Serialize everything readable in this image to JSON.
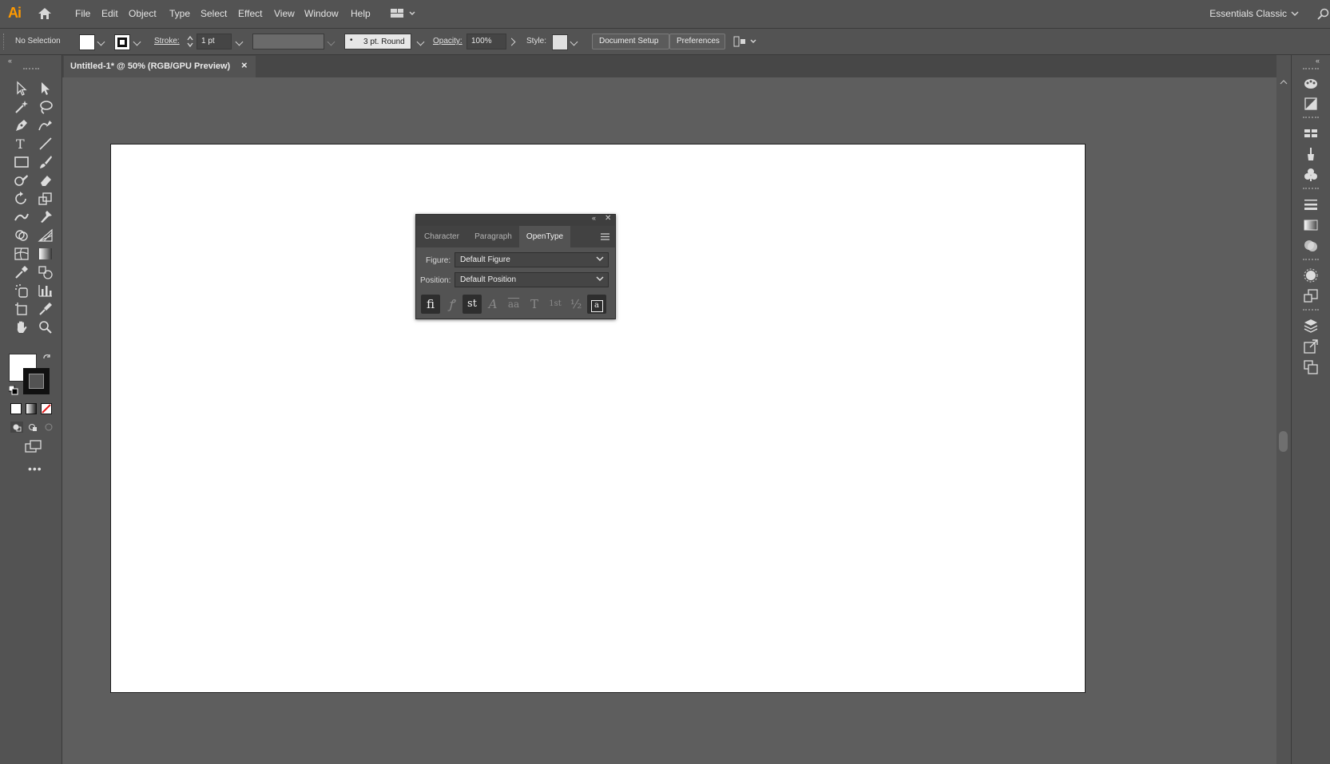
{
  "app": {
    "logo": "Ai",
    "workspace": "Essentials Classic"
  },
  "menu": [
    "File",
    "Edit",
    "Object",
    "Type",
    "Select",
    "Effect",
    "View",
    "Window",
    "Help"
  ],
  "control_bar": {
    "selection": "No Selection",
    "stroke_label": "Stroke:",
    "stroke_value": "1 pt",
    "brush": "3 pt. Round",
    "opacity_label": "Opacity:",
    "opacity_value": "100%",
    "style_label": "Style:",
    "document_setup": "Document Setup",
    "preferences": "Preferences"
  },
  "document_tab": {
    "title": "Untitled-1* @ 50% (RGB/GPU Preview)",
    "close": "×"
  },
  "opentype_panel": {
    "tabs": [
      "Character",
      "Paragraph",
      "OpenType"
    ],
    "active_tab": "OpenType",
    "figure_label": "Figure:",
    "figure_value": "Default Figure",
    "position_label": "Position:",
    "position_value": "Default Position",
    "glyph_buttons": [
      "ﬁ",
      "ꝭ",
      "st",
      "A",
      "aa",
      "T",
      "1st",
      "½",
      "a"
    ]
  },
  "colors": {
    "ui_bg": "#535353",
    "canvas_bg": "#5e5e5e",
    "artboard": "#ffffff",
    "logo": "#ff9a00"
  }
}
